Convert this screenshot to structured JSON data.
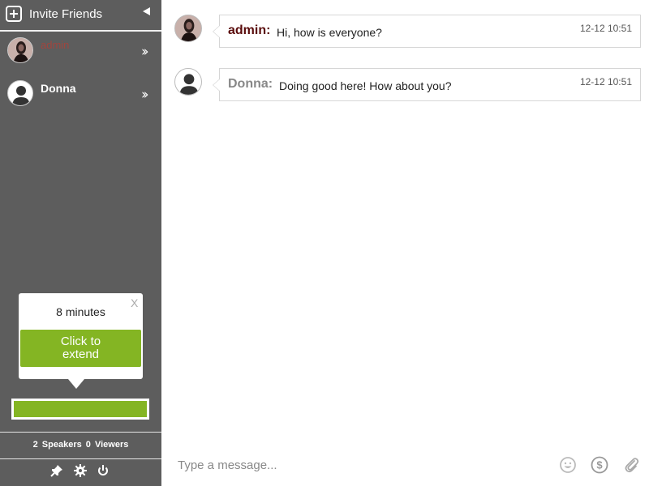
{
  "sidebar": {
    "invite_label": "Invite Friends",
    "users": [
      {
        "name": "admin",
        "color": "#a0453e",
        "avatar": "admin-photo"
      },
      {
        "name": "Donna",
        "color": "#ffffff",
        "avatar": "default-user-icon"
      }
    ],
    "timer": {
      "minutes_text": "8 minutes",
      "close_label": "X",
      "extend_label_line1": "Click to",
      "extend_label_line2": "extend"
    },
    "counts": {
      "speakers_value": "2",
      "speakers_label": "Speakers",
      "viewers_value": "0",
      "viewers_label": "Viewers"
    },
    "footer_icons": [
      "pin-icon",
      "gear-icon",
      "power-icon"
    ]
  },
  "chat": {
    "messages": [
      {
        "sender": "admin:",
        "text": "Hi, how is everyone?",
        "time": "12-12 10:51",
        "sender_color": "#5a0c0c"
      },
      {
        "sender": "Donna:",
        "text": "Doing good here! How about you?",
        "time": "12-12 10:51",
        "sender_color": "#888888"
      }
    ],
    "composer": {
      "placeholder": "Type a message...",
      "icons": [
        "emoji-icon",
        "dollar-icon",
        "attachment-icon"
      ]
    }
  },
  "colors": {
    "sidebar_bg": "#5d5d5d",
    "accent_green": "#84b523"
  }
}
